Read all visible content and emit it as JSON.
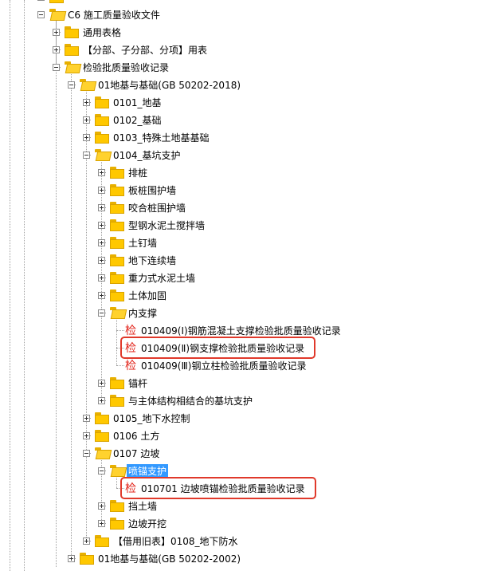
{
  "tree": {
    "items": [
      {
        "label": "C6 施工质量验收文件",
        "level": 1,
        "expanded": true
      },
      {
        "label": "通用表格",
        "level": 2,
        "expanded": false
      },
      {
        "label": "【分部、子分部、分项】用表",
        "level": 2,
        "expanded": false
      },
      {
        "label": "检验批质量验收记录",
        "level": 2,
        "expanded": true
      },
      {
        "label": "01地基与基础(GB 50202-2018)",
        "level": 3,
        "expanded": true
      },
      {
        "label": "0101_地基",
        "level": 4,
        "expanded": false
      },
      {
        "label": "0102_基础",
        "level": 4,
        "expanded": false
      },
      {
        "label": "0103_特殊土地基基础",
        "level": 4,
        "expanded": false
      },
      {
        "label": "0104_基坑支护",
        "level": 4,
        "expanded": true
      },
      {
        "label": "排桩",
        "level": 5,
        "expanded": false
      },
      {
        "label": "板桩围护墙",
        "level": 5,
        "expanded": false
      },
      {
        "label": "咬合桩围护墙",
        "level": 5,
        "expanded": false
      },
      {
        "label": "型钢水泥土搅拌墙",
        "level": 5,
        "expanded": false
      },
      {
        "label": "土钉墙",
        "level": 5,
        "expanded": false
      },
      {
        "label": "地下连续墙",
        "level": 5,
        "expanded": false
      },
      {
        "label": "重力式水泥土墙",
        "level": 5,
        "expanded": false
      },
      {
        "label": "土体加固",
        "level": 5,
        "expanded": false
      },
      {
        "label": "内支撑",
        "level": 5,
        "expanded": true
      },
      {
        "label": "010409(Ⅰ)钢筋混凝土支撑检验批质量验收记录",
        "level": 6,
        "leaf": true
      },
      {
        "label": "010409(Ⅱ)钢支撑检验批质量验收记录",
        "level": 6,
        "leaf": true
      },
      {
        "label": "010409(Ⅲ)钢立柱检验批质量验收记录",
        "level": 6,
        "leaf": true
      },
      {
        "label": "锚杆",
        "level": 5,
        "expanded": false
      },
      {
        "label": "与主体结构相结合的基坑支护",
        "level": 5,
        "expanded": false
      },
      {
        "label": "0105_地下水控制",
        "level": 4,
        "expanded": false
      },
      {
        "label": "0106 土方",
        "level": 4,
        "expanded": false
      },
      {
        "label": "0107 边坡",
        "level": 4,
        "expanded": true
      },
      {
        "label": "喷锚支护",
        "level": 5,
        "expanded": true,
        "selected": true
      },
      {
        "label": "010701 边坡喷锚检验批质量验收记录",
        "level": 6,
        "leaf": true
      },
      {
        "label": "挡土墙",
        "level": 5,
        "expanded": false
      },
      {
        "label": "边坡开挖",
        "level": 5,
        "expanded": false
      },
      {
        "label": "【借用旧表】0108_地下防水",
        "level": 4,
        "expanded": false
      },
      {
        "label": "01地基与基础(GB 50202-2002)",
        "level": 3,
        "expanded": false
      }
    ],
    "leaf_badge": "检",
    "highlighted_items": [
      "010409(Ⅱ)钢支撑检验批质量验收记录",
      "010701 边坡喷锚检验批质量验收记录"
    ]
  },
  "colors": {
    "folder": "#ffc800",
    "badge": "#e2231a",
    "selection": "#3399ff",
    "highlight_border": "#e0392b"
  },
  "icons": [
    "expand-icon",
    "collapse-icon",
    "folder-icon",
    "folder-open-icon",
    "inspection-badge-icon"
  ]
}
